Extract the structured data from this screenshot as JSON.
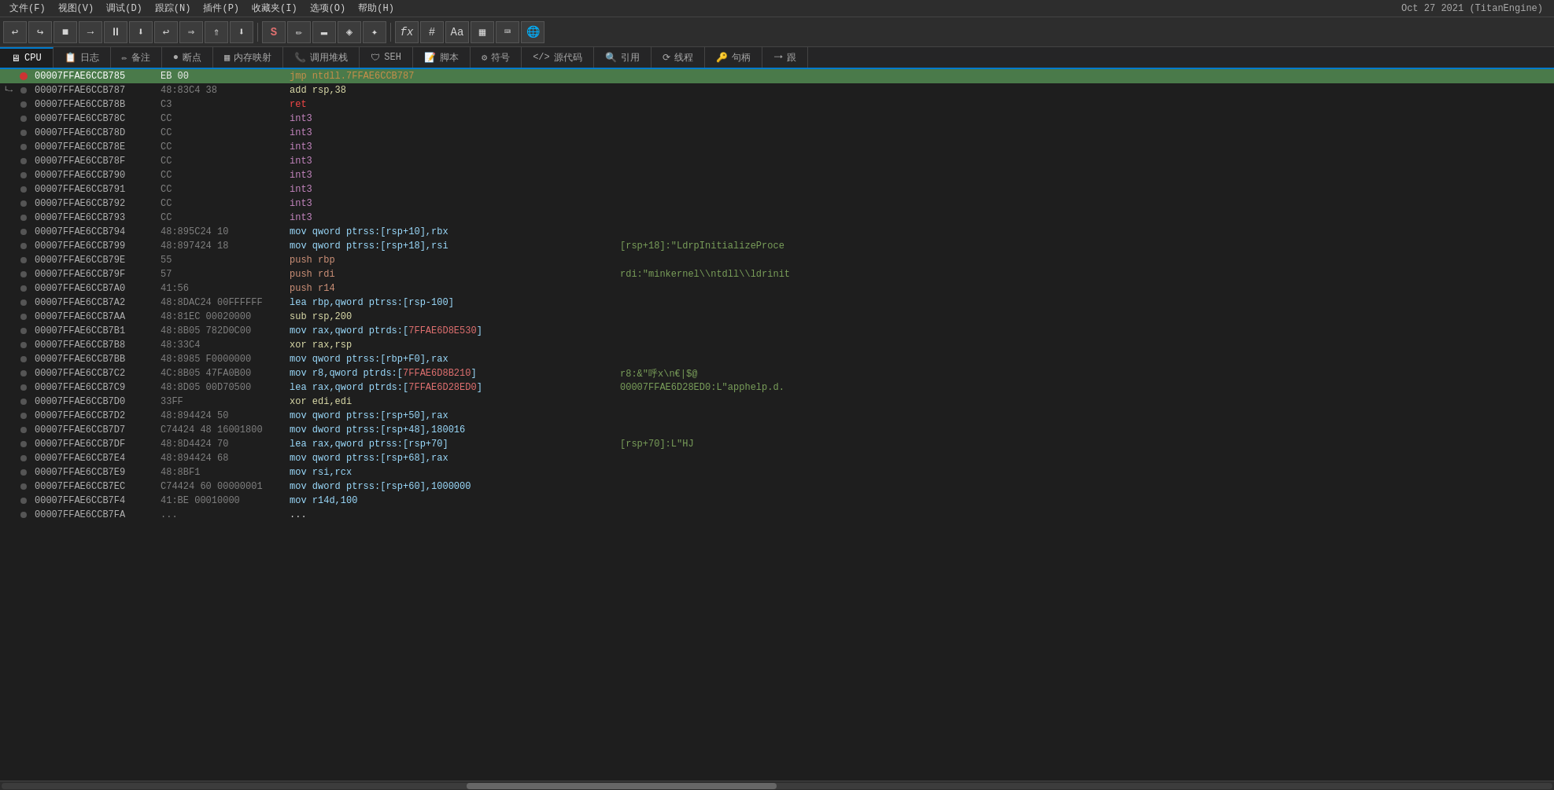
{
  "menubar": {
    "items": [
      "文件(F)",
      "视图(V)",
      "调试(D)",
      "跟踪(N)",
      "插件(P)",
      "收藏夹(I)",
      "选项(O)",
      "帮助(H)"
    ],
    "title": "Oct 27 2021 (TitanEngine)"
  },
  "toolbar": {
    "buttons": [
      "↩",
      "↪",
      "■",
      "→",
      "⏸",
      "⬇",
      "↩",
      "⇒",
      "⇑",
      "→⬇",
      "S",
      "✏",
      "▬",
      "◈",
      "⁕",
      "fx",
      "#",
      "Aa",
      "▦",
      "⌨",
      "🌐"
    ]
  },
  "tabs": [
    {
      "label": "CPU",
      "icon": "cpu",
      "active": true
    },
    {
      "label": "日志",
      "icon": "log",
      "active": false
    },
    {
      "label": "备注",
      "icon": "notes",
      "active": false
    },
    {
      "label": "断点",
      "icon": "breakpoint",
      "active": false
    },
    {
      "label": "内存映射",
      "icon": "memory",
      "active": false
    },
    {
      "label": "调用堆栈",
      "icon": "callstack",
      "active": false
    },
    {
      "label": "SEH",
      "icon": "seh",
      "active": false
    },
    {
      "label": "脚本",
      "icon": "script",
      "active": false
    },
    {
      "label": "符号",
      "icon": "symbols",
      "active": false
    },
    {
      "label": "源代码",
      "icon": "source",
      "active": false
    },
    {
      "label": "引用",
      "icon": "refs",
      "active": false
    },
    {
      "label": "线程",
      "icon": "threads",
      "active": false
    },
    {
      "label": "句柄",
      "icon": "handles",
      "active": false
    },
    {
      "label": "跟",
      "icon": "trace",
      "active": false
    }
  ],
  "disasm": {
    "rows": [
      {
        "addr": "00007FFAE6CCB785",
        "bp": "red",
        "bytes": "EB 00",
        "instr": "jmp ntdll.7FFAE6CCB787",
        "comment": "",
        "type": "jmp",
        "highlighted": true,
        "arrow": ""
      },
      {
        "addr": "00007FFAE6CCB787",
        "bp": "",
        "bytes": "48:83C4 38",
        "instr": "add rsp,38",
        "comment": "",
        "type": "add",
        "highlighted": false,
        "arrow": "arrow"
      },
      {
        "addr": "00007FFAE6CCB78B",
        "bp": "",
        "bytes": "C3",
        "instr": "ret",
        "comment": "",
        "type": "ret",
        "highlighted": false,
        "arrow": ""
      },
      {
        "addr": "00007FFAE6CCB78C",
        "bp": "",
        "bytes": "CC",
        "instr": "int3",
        "comment": "",
        "type": "int",
        "highlighted": false,
        "arrow": ""
      },
      {
        "addr": "00007FFAE6CCB78D",
        "bp": "",
        "bytes": "CC",
        "instr": "int3",
        "comment": "",
        "type": "int",
        "highlighted": false,
        "arrow": ""
      },
      {
        "addr": "00007FFAE6CCB78E",
        "bp": "",
        "bytes": "CC",
        "instr": "int3",
        "comment": "",
        "type": "int",
        "highlighted": false,
        "arrow": ""
      },
      {
        "addr": "00007FFAE6CCB78F",
        "bp": "",
        "bytes": "CC",
        "instr": "int3",
        "comment": "",
        "type": "int",
        "highlighted": false,
        "arrow": ""
      },
      {
        "addr": "00007FFAE6CCB790",
        "bp": "",
        "bytes": "CC",
        "instr": "int3",
        "comment": "",
        "type": "int",
        "highlighted": false,
        "arrow": ""
      },
      {
        "addr": "00007FFAE6CCB791",
        "bp": "",
        "bytes": "CC",
        "instr": "int3",
        "comment": "",
        "type": "int",
        "highlighted": false,
        "arrow": ""
      },
      {
        "addr": "00007FFAE6CCB792",
        "bp": "",
        "bytes": "CC",
        "instr": "int3",
        "comment": "",
        "type": "int",
        "highlighted": false,
        "arrow": ""
      },
      {
        "addr": "00007FFAE6CCB793",
        "bp": "",
        "bytes": "CC",
        "instr": "int3",
        "comment": "",
        "type": "int",
        "highlighted": false,
        "arrow": ""
      },
      {
        "addr": "00007FFAE6CCB794",
        "bp": "",
        "bytes": "48:895C24 10",
        "instr": "mov qword ptrss:[rsp+10],rbx",
        "comment": "",
        "type": "mov",
        "highlighted": false,
        "arrow": ""
      },
      {
        "addr": "00007FFAE6CCB799",
        "bp": "",
        "bytes": "48:897424 18",
        "instr": "mov qword ptrss:[rsp+18],rsi",
        "comment": "[rsp+18]:\"LdrpInitializeProce",
        "type": "mov",
        "highlighted": false,
        "arrow": ""
      },
      {
        "addr": "00007FFAE6CCB79E",
        "bp": "",
        "bytes": "55",
        "instr": "push rbp",
        "comment": "",
        "type": "push",
        "highlighted": false,
        "arrow": ""
      },
      {
        "addr": "00007FFAE6CCB79F",
        "bp": "",
        "bytes": "57",
        "instr": "push rdi",
        "comment": "rdi:\"minkernel\\\\ntdll\\\\ldrinit",
        "type": "push",
        "highlighted": false,
        "arrow": ""
      },
      {
        "addr": "00007FFAE6CCB7A0",
        "bp": "",
        "bytes": "41:56",
        "instr": "push r14",
        "comment": "",
        "type": "push",
        "highlighted": false,
        "arrow": ""
      },
      {
        "addr": "00007FFAE6CCB7A2",
        "bp": "",
        "bytes": "48:8DAC24 00FFFFFF",
        "instr": "lea rbp,qword ptrss:[rsp-100]",
        "comment": "",
        "type": "lea",
        "highlighted": false,
        "arrow": ""
      },
      {
        "addr": "00007FFAE6CCB7AA",
        "bp": "",
        "bytes": "48:81EC 00020000",
        "instr": "sub rsp,200",
        "comment": "",
        "type": "sub",
        "highlighted": false,
        "arrow": ""
      },
      {
        "addr": "00007FFAE6CCB7B1",
        "bp": "",
        "bytes": "48:8B05 782D0C00",
        "instr": "mov rax,qword ptrds:[7FFAE6D8E530]",
        "comment": "",
        "type": "mov",
        "highlighted": false,
        "arrow": "",
        "addr_red": "7FFAE6D8E530"
      },
      {
        "addr": "00007FFAE6CCB7B8",
        "bp": "",
        "bytes": "48:33C4",
        "instr": "xor rax,rsp",
        "comment": "",
        "type": "xor",
        "highlighted": false,
        "arrow": ""
      },
      {
        "addr": "00007FFAE6CCB7BB",
        "bp": "",
        "bytes": "48:8985 F0000000",
        "instr": "mov qword ptrss:[rbp+F0],rax",
        "comment": "",
        "type": "mov",
        "highlighted": false,
        "arrow": ""
      },
      {
        "addr": "00007FFAE6CCB7C2",
        "bp": "",
        "bytes": "4C:8B05 47FA0B00",
        "instr": "mov r8,qword ptrds:[7FFAE6D8B210]",
        "comment": "r8:&\"呼x\\n€|$@",
        "type": "mov",
        "highlighted": false,
        "arrow": "",
        "addr_red": "7FFAE6D8B210"
      },
      {
        "addr": "00007FFAE6CCB7C9",
        "bp": "",
        "bytes": "48:8D05 00D70500",
        "instr": "lea rax,qword ptrds:[7FFAE6D28ED0]",
        "comment": "00007FFAE6D28ED0:L\"apphelp.d.",
        "type": "lea",
        "highlighted": false,
        "arrow": "",
        "addr_red": "7FFAE6D28ED0"
      },
      {
        "addr": "00007FFAE6CCB7D0",
        "bp": "",
        "bytes": "33FF",
        "instr": "xor edi,edi",
        "comment": "",
        "type": "xor",
        "highlighted": false,
        "arrow": ""
      },
      {
        "addr": "00007FFAE6CCB7D2",
        "bp": "",
        "bytes": "48:894424 50",
        "instr": "mov qword ptrss:[rsp+50],rax",
        "comment": "",
        "type": "mov",
        "highlighted": false,
        "arrow": ""
      },
      {
        "addr": "00007FFAE6CCB7D7",
        "bp": "",
        "bytes": "C74424 48 16001800",
        "instr": "mov dword ptrss:[rsp+48],180016",
        "comment": "",
        "type": "mov",
        "highlighted": false,
        "arrow": ""
      },
      {
        "addr": "00007FFAE6CCB7DF",
        "bp": "",
        "bytes": "48:8D4424 70",
        "instr": "lea rax,qword ptrss:[rsp+70]",
        "comment": "[rsp+70]:L\"HJ",
        "type": "lea",
        "highlighted": false,
        "arrow": ""
      },
      {
        "addr": "00007FFAE6CCB7E4",
        "bp": "",
        "bytes": "48:894424 68",
        "instr": "mov qword ptrss:[rsp+68],rax",
        "comment": "",
        "type": "mov",
        "highlighted": false,
        "arrow": ""
      },
      {
        "addr": "00007FFAE6CCB7E9",
        "bp": "",
        "bytes": "48:8BF1",
        "instr": "mov rsi,rcx",
        "comment": "",
        "type": "mov",
        "highlighted": false,
        "arrow": ""
      },
      {
        "addr": "00007FFAE6CCB7EC",
        "bp": "",
        "bytes": "C74424 60 00000001",
        "instr": "mov dword ptrss:[rsp+60],1000000",
        "comment": "",
        "type": "mov",
        "highlighted": false,
        "arrow": ""
      },
      {
        "addr": "00007FFAE6CCB7F4",
        "bp": "",
        "bytes": "41:BE 00010000",
        "instr": "mov r14d,100",
        "comment": "",
        "type": "mov",
        "highlighted": false,
        "arrow": ""
      },
      {
        "addr": "00007FFAE6CCB7FA",
        "bp": "",
        "bytes": "...",
        "instr": "...",
        "comment": "",
        "type": "default",
        "highlighted": false,
        "arrow": ""
      }
    ]
  }
}
